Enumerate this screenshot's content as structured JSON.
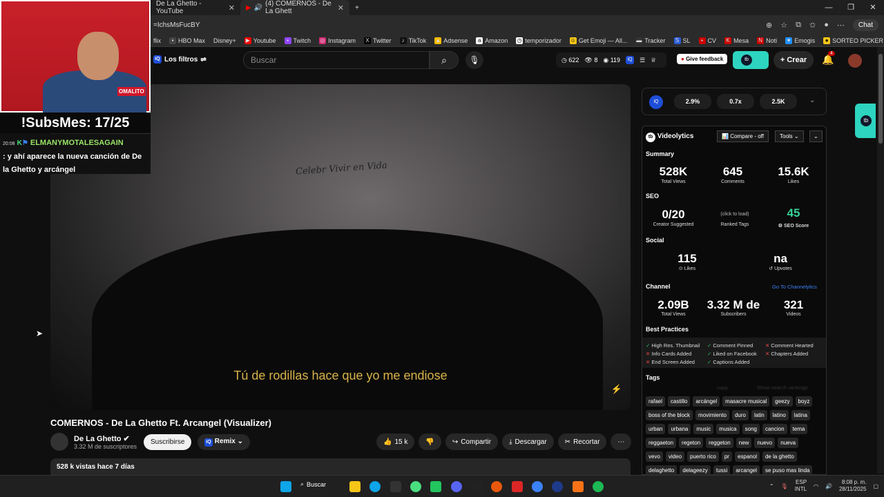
{
  "browser": {
    "tabs": [
      {
        "title": "De La Ghetto - YouTube"
      },
      {
        "title": "(4) COMERNOS - De La Ghett"
      }
    ],
    "url": "=IchsMsFucBY",
    "chat_label": "Chat",
    "bookmarks": [
      "flix",
      "HBO Max",
      "Disney+",
      "Youtube",
      "Twitch",
      "Instagram",
      "Twitter",
      "TikTok",
      "Adsense",
      "Amazon",
      "temporizador",
      "Get Emoji — All...",
      "Tracker",
      "SL",
      "CV",
      "Mesa",
      "Noti",
      "Emogis",
      "SORTEO PICKER"
    ]
  },
  "header": {
    "filters_label": "Los filtros",
    "search_placeholder": "Buscar",
    "stats": [
      "622",
      "8",
      "119"
    ],
    "feedback_label": "Give feedback",
    "create_label": "Crear",
    "notif_count": "4"
  },
  "video": {
    "subtitle": "Tú de rodillas hace que yo me endiose",
    "tattoo": "Celebr Vivir en Vida",
    "title": "COMERNOS - De La Ghetto Ft. Arcangel (Visualizer)",
    "channel": "De La Ghetto",
    "subs": "3.32 M de suscriptores",
    "subscribe": "Suscribirse",
    "remix": "Remix",
    "likes": "15 k",
    "share": "Compartir",
    "download": "Descargar",
    "clip": "Recortar",
    "views_line": "528 k vistas  hace 7 días"
  },
  "vidiq": {
    "top": [
      "2.9%",
      "0.7x",
      "2.5K"
    ],
    "brand": "Videolytics",
    "compare": "Compare - off",
    "tools": "Tools",
    "summary": {
      "label": "Summary",
      "views": "528K",
      "views_l": "Total Views",
      "comments": "645",
      "comments_l": "Comments",
      "likes": "15.6K",
      "likes_l": "Likes"
    },
    "seo": {
      "label": "SEO",
      "creator": "0/20",
      "creator_l": "Creator Suggested",
      "ranked_hint": "(click to load)",
      "ranked_l": "Ranked Tags",
      "score": "45",
      "score_l": "SEO Score"
    },
    "social": {
      "label": "Social",
      "likes": "115",
      "likes_l": "Likes",
      "upvotes": "na",
      "upvotes_l": "Upvotes"
    },
    "channel": {
      "label": "Channel",
      "link": "Go To Channelytics",
      "views": "2.09B",
      "views_l": "Total Views",
      "subs": "3.32 M de",
      "subs_l": "Subscribers",
      "videos": "321",
      "videos_l": "Videos"
    },
    "best": {
      "label": "Best Practices",
      "items": [
        "High Res. Thumbnail",
        "Comment Pinned",
        "Comment Hearted",
        "Info Cards Added",
        "Liked on Facebook",
        "Chapters Added",
        "End Screen Added",
        "Captions Added"
      ]
    },
    "tags_label": "Tags",
    "tags_actions": [
      "copy",
      "Show search rankings"
    ],
    "tags": [
      [
        "rafael",
        "castillo",
        "arcángel",
        "masacre musical",
        "geezy",
        "boyz"
      ],
      [
        "boss of the block",
        "movimiento",
        "duro",
        "latin",
        "latino",
        "latina"
      ],
      [
        "urban",
        "urbana",
        "music",
        "musica",
        "song",
        "cancion",
        "tema"
      ],
      [
        "reggaeton",
        "regeton",
        "reggeton",
        "new",
        "nuevo",
        "nueva"
      ],
      [
        "vevo",
        "video",
        "puerto rico",
        "pr",
        "espanol",
        "de la ghetto"
      ],
      [
        "delaghetto",
        "delageezy",
        "tussi",
        "arcangel",
        "se puso mas linda"
      ]
    ]
  },
  "overlay": {
    "subs": "!SubsMes: 17/25",
    "chat_time": "20:08",
    "chat_user": "ELMANYMOTALESAGAIN",
    "chat_text": ": y ahí aparece la nueva canción de De la Ghetto y arcángel",
    "logo": "OMALITO"
  },
  "taskbar": {
    "search": "Buscar",
    "lang": "ESP",
    "lang2": "INTL",
    "time": "8:08 p. m.",
    "date": "28/11/2025"
  }
}
